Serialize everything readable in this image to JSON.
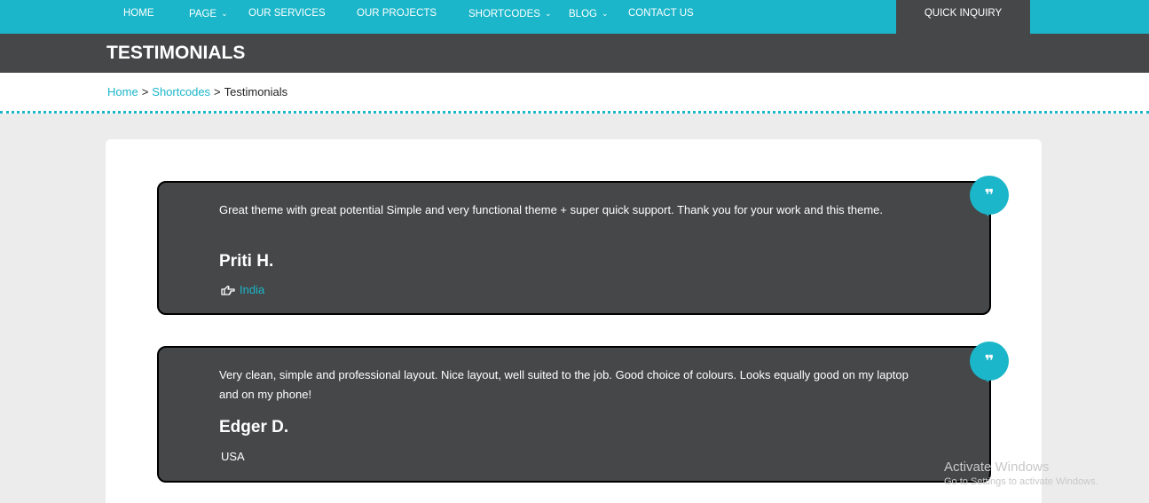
{
  "nav": {
    "items": [
      {
        "label": "HOME",
        "dropdown": false
      },
      {
        "label": "PAGE",
        "dropdown": true
      },
      {
        "label": "OUR SERVICES",
        "dropdown": false
      },
      {
        "label": "OUR PROJECTS",
        "dropdown": false
      },
      {
        "label": "SHORTCODES",
        "dropdown": true
      },
      {
        "label": "BLOG",
        "dropdown": true
      },
      {
        "label": "CONTACT US",
        "dropdown": false
      }
    ],
    "cta_label": "QUICK INQUIRY"
  },
  "page": {
    "title": "TESTIMONIALS"
  },
  "breadcrumb": {
    "items": [
      "Home",
      "Shortcodes",
      "Testimonials"
    ],
    "separator": ">"
  },
  "testimonials": [
    {
      "text": "Great theme with great potential Simple and very functional theme + super quick support. Thank you for your work and this theme.",
      "author": "Priti H.",
      "location": "India"
    },
    {
      "text": "Very clean, simple and professional layout. Nice layout, well suited to the job. Good choice of colours. Looks equally good on my laptop and on my phone!",
      "author": "Edger D.",
      "location": "USA"
    }
  ],
  "watermark": {
    "title": "Activate Windows",
    "subtitle": "Go to Settings to activate Windows."
  },
  "icons": {
    "quote": "quote-icon",
    "hand": "hand-pointing-icon",
    "chevron": "chevron-down-icon"
  },
  "colors": {
    "accent": "#1bb6c9",
    "dark": "#454749",
    "panel_bg": "#ffffff",
    "page_bg": "#ececec"
  }
}
